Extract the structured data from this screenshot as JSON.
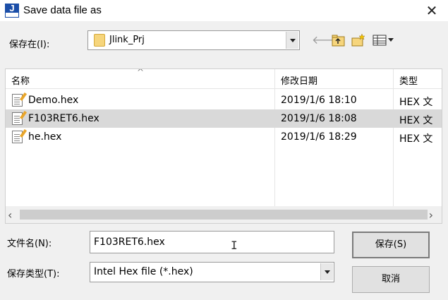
{
  "window": {
    "title": "Save data file as",
    "app_icon_letter": "J",
    "close_glyph": "✕"
  },
  "lookin": {
    "label": "保存在(I):",
    "value": "Jlink_Prj"
  },
  "toolbar": {
    "icons": [
      "back-arrow-icon",
      "up-folder-icon",
      "new-folder-icon",
      "view-menu-icon"
    ]
  },
  "listview": {
    "columns": [
      "名称",
      "修改日期",
      "类型"
    ],
    "rows": [
      {
        "name": "Demo.hex",
        "modified": "2019/1/6 18:10",
        "type": "HEX 文"
      },
      {
        "name": "F103RET6.hex",
        "modified": "2019/1/6 18:08",
        "type": "HEX 文",
        "selected": true
      },
      {
        "name": "he.hex",
        "modified": "2019/1/6 18:29",
        "type": "HEX 文"
      }
    ]
  },
  "filename": {
    "label": "文件名(N):",
    "value": "F103RET6.hex"
  },
  "filetype": {
    "label": "保存类型(T):",
    "value": "Intel Hex file (*.hex)"
  },
  "buttons": {
    "save": "保存(S)",
    "cancel": "取消"
  },
  "colors": {
    "selected_row": "#d9d9d9",
    "app_icon": "#1b4ea8",
    "folder": "#f6d57c"
  }
}
